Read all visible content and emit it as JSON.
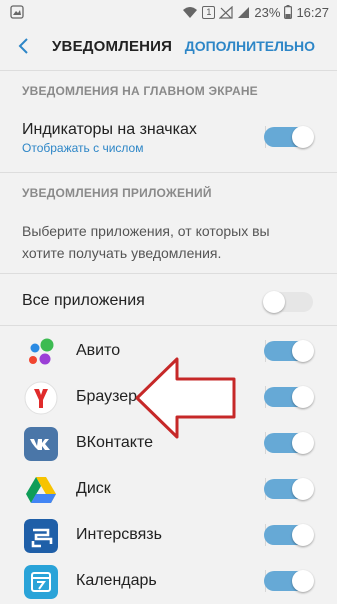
{
  "status_bar": {
    "notification_count": "1",
    "battery": "23%",
    "time": "16:27"
  },
  "header": {
    "title": "УВЕДОМЛЕНИЯ",
    "more_label": "ДОПОЛНИТЕЛЬНО"
  },
  "section_home": {
    "heading": "УВЕДОМЛЕНИЯ НА ГЛАВНОМ ЭКРАНЕ",
    "badge_title": "Индикаторы на значках",
    "badge_sub": "Отображать с числом",
    "badge_on": true
  },
  "section_apps": {
    "heading": "УВЕДОМЛЕНИЯ ПРИЛОЖЕНИЙ",
    "description": "Выберите приложения, от которых вы хотите получать уведомления.",
    "all_apps_label": "Все приложения",
    "all_apps_on": false
  },
  "apps": [
    {
      "name": "Авито",
      "icon": "avito-icon",
      "on": true
    },
    {
      "name": "Браузер",
      "icon": "yandex-browser-icon",
      "on": true
    },
    {
      "name": "ВКонтакте",
      "icon": "vk-icon",
      "on": true
    },
    {
      "name": "Диск",
      "icon": "google-drive-icon",
      "on": true
    },
    {
      "name": "Интерсвязь",
      "icon": "intersvyaz-icon",
      "on": true
    },
    {
      "name": "Календарь",
      "icon": "calendar-icon",
      "on": true
    }
  ],
  "colors": {
    "accent": "#2d86c7",
    "toggle_on": "#66a9d6",
    "arrow": "#c62828"
  }
}
